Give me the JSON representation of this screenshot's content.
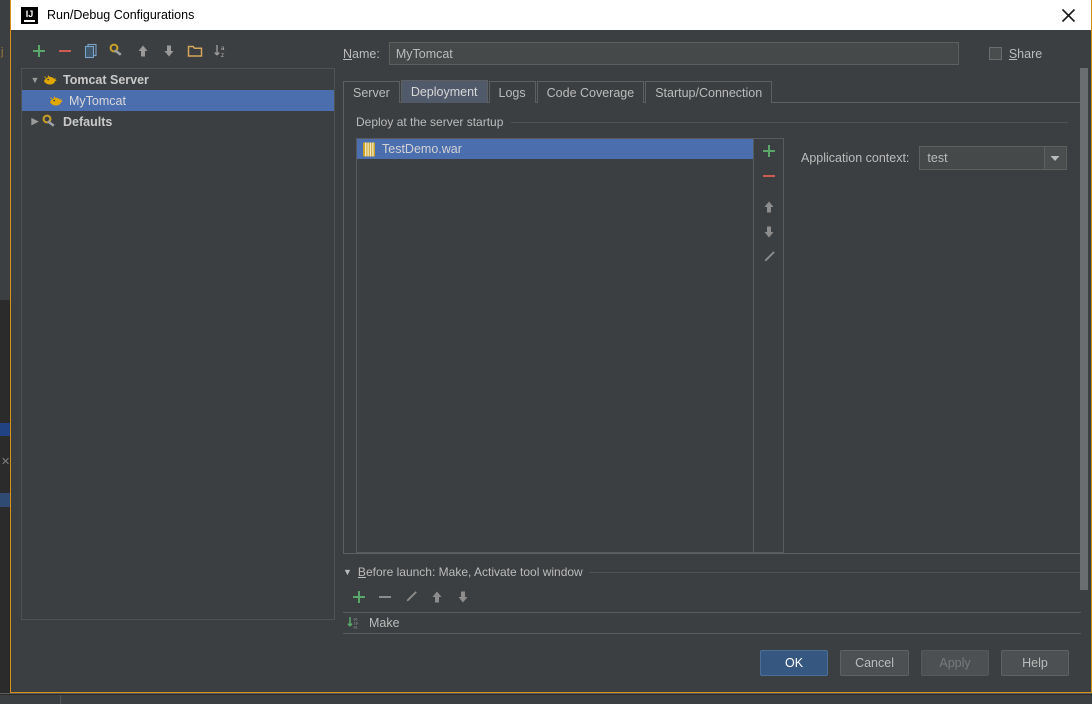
{
  "window": {
    "title": "Run/Debug Configurations",
    "logo_text": "IJ",
    "close_icon": "close-icon"
  },
  "tree_toolbar": [
    {
      "name": "add-configuration-button",
      "icon": "plus-icon"
    },
    {
      "name": "remove-configuration-button",
      "icon": "minus-icon"
    },
    {
      "name": "copy-configuration-button",
      "icon": "copy-icon"
    },
    {
      "name": "save-configuration-button",
      "icon": "wrench-icon"
    },
    {
      "name": "move-up-button",
      "icon": "arrow-up-icon"
    },
    {
      "name": "move-down-button",
      "icon": "arrow-down-icon"
    },
    {
      "name": "create-folder-button",
      "icon": "folder-icon"
    },
    {
      "name": "sort-configurations-button",
      "icon": "sort-az-icon"
    }
  ],
  "tree": {
    "items": [
      {
        "label": "Tomcat Server",
        "icon": "tomcat-icon",
        "expanded": true,
        "bold": true,
        "level": 0,
        "selected": false
      },
      {
        "label": "MyTomcat",
        "icon": "tomcat-icon",
        "expanded": null,
        "bold": false,
        "level": 1,
        "selected": true
      },
      {
        "label": "Defaults",
        "icon": "wrench-icon",
        "expanded": false,
        "bold": true,
        "level": 0,
        "selected": false
      }
    ]
  },
  "name_field": {
    "label": "Name:",
    "label_mnemonic": "N",
    "label_rest": "ame:",
    "value": "MyTomcat",
    "placeholder": ""
  },
  "share": {
    "label_mnemonic": "S",
    "label_rest": "hare",
    "checked": false
  },
  "tabs": [
    {
      "label": "Server",
      "active": false
    },
    {
      "label": "Deployment",
      "active": true
    },
    {
      "label": "Logs",
      "active": false
    },
    {
      "label": "Code Coverage",
      "active": false
    },
    {
      "label": "Startup/Connection",
      "active": false
    }
  ],
  "deployment": {
    "group_label": "Deploy at the server startup",
    "artifacts": [
      {
        "label": "TestDemo.war",
        "icon": "war-archive-icon",
        "selected": true
      }
    ],
    "list_toolbar": [
      {
        "name": "add-artifact-button",
        "icon": "plus-icon"
      },
      {
        "name": "remove-artifact-button",
        "icon": "minus-icon"
      },
      {
        "name": "move-artifact-up-button",
        "icon": "arrow-up-icon"
      },
      {
        "name": "move-artifact-down-button",
        "icon": "arrow-down-icon"
      },
      {
        "name": "edit-artifact-button",
        "icon": "pencil-icon"
      }
    ],
    "application_context": {
      "label": "Application context:",
      "value": "test",
      "options": [
        "test"
      ]
    }
  },
  "before_launch": {
    "header_mnemonic": "B",
    "header_rest": "efore launch: Make, Activate tool window",
    "toolbar": [
      {
        "name": "add-task-button",
        "icon": "plus-icon"
      },
      {
        "name": "remove-task-button",
        "icon": "minus-icon"
      },
      {
        "name": "edit-task-button",
        "icon": "pencil-icon"
      },
      {
        "name": "move-task-up-button",
        "icon": "arrow-up-icon"
      },
      {
        "name": "move-task-down-button",
        "icon": "arrow-down-icon"
      }
    ],
    "tasks": [
      {
        "label": "Make",
        "icon": "make-build-icon"
      }
    ]
  },
  "footer_buttons": [
    {
      "label": "OK",
      "style": "primary",
      "enabled": true
    },
    {
      "label": "Cancel",
      "style": "normal",
      "enabled": true
    },
    {
      "label": "Apply",
      "style": "disabled",
      "enabled": false
    },
    {
      "label": "Help",
      "style": "normal",
      "enabled": true
    }
  ],
  "colors": {
    "window_border": "#d68f17",
    "dialog_bg": "#3c3f41",
    "selection_blue": "#4b6eaf",
    "active_tab_bg": "#515a6b",
    "primary_button": "#365880",
    "add_green": "#59a869",
    "remove_red": "#cc5b52",
    "text": "#bbbbbb"
  }
}
